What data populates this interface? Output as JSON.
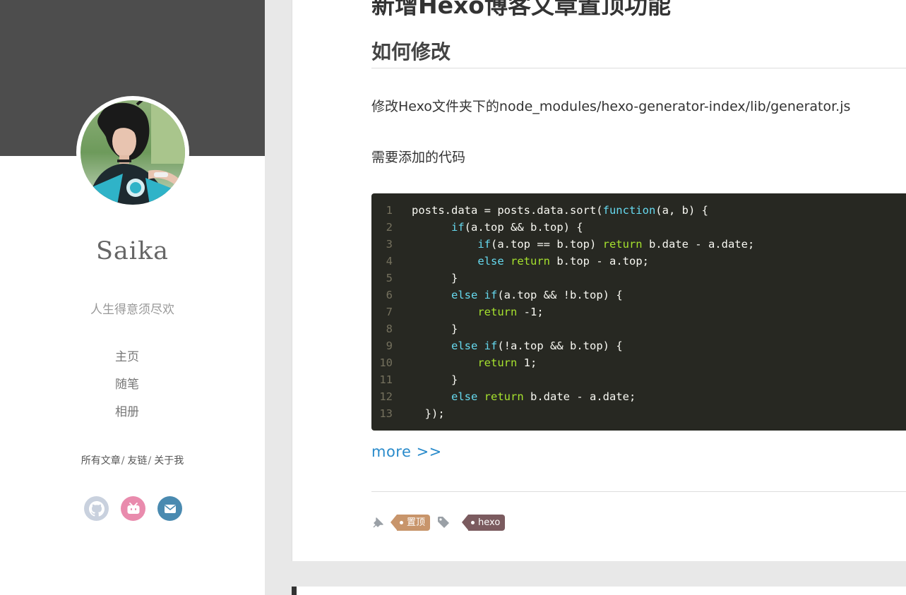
{
  "sidebar": {
    "author_name": "Saika",
    "motto": "人生得意须尽欢",
    "nav": [
      {
        "label": "主页"
      },
      {
        "label": "随笔"
      },
      {
        "label": "相册"
      }
    ],
    "sub_nav": [
      {
        "label": "所有文章"
      },
      {
        "label": "友链"
      },
      {
        "label": "关于我"
      }
    ],
    "sub_nav_separator": "/",
    "socials": [
      {
        "icon": "github-icon",
        "color": "#c9d1de"
      },
      {
        "icon": "bilibili-icon",
        "color": "#e98bad"
      },
      {
        "icon": "email-icon",
        "color": "#4a8ab0"
      }
    ]
  },
  "post": {
    "title": "新增Hexo博客文章置顶功能",
    "section_heading": "如何修改",
    "paragraph_1": "修改Hexo文件夹下的node_modules/hexo-generator-index/lib/generator.js",
    "paragraph_2": "需要添加的代码",
    "code_lines": [
      {
        "n": "1",
        "indent": "",
        "parts": [
          [
            "t",
            "posts.data = posts.data.sort("
          ],
          [
            "kw",
            "function"
          ],
          [
            "t",
            "(a, b) {"
          ]
        ]
      },
      {
        "n": "2",
        "indent": "      ",
        "parts": [
          [
            "kw",
            "if"
          ],
          [
            "t",
            "(a.top && b.top) {"
          ]
        ]
      },
      {
        "n": "3",
        "indent": "          ",
        "parts": [
          [
            "kw",
            "if"
          ],
          [
            "t",
            "(a.top == b.top) "
          ],
          [
            "kw2",
            "return"
          ],
          [
            "t",
            " b.date - a.date;"
          ]
        ]
      },
      {
        "n": "4",
        "indent": "          ",
        "parts": [
          [
            "kw",
            "else"
          ],
          [
            "t",
            " "
          ],
          [
            "kw2",
            "return"
          ],
          [
            "t",
            " b.top - a.top;"
          ]
        ]
      },
      {
        "n": "5",
        "indent": "      ",
        "parts": [
          [
            "t",
            "}"
          ]
        ]
      },
      {
        "n": "6",
        "indent": "      ",
        "parts": [
          [
            "kw",
            "else"
          ],
          [
            "t",
            " "
          ],
          [
            "kw",
            "if"
          ],
          [
            "t",
            "(a.top && !b.top) {"
          ]
        ]
      },
      {
        "n": "7",
        "indent": "          ",
        "parts": [
          [
            "kw2",
            "return"
          ],
          [
            "t",
            " -1;"
          ]
        ]
      },
      {
        "n": "8",
        "indent": "      ",
        "parts": [
          [
            "t",
            "}"
          ]
        ]
      },
      {
        "n": "9",
        "indent": "      ",
        "parts": [
          [
            "kw",
            "else"
          ],
          [
            "t",
            " "
          ],
          [
            "kw",
            "if"
          ],
          [
            "t",
            "(!a.top && b.top) {"
          ]
        ]
      },
      {
        "n": "10",
        "indent": "          ",
        "parts": [
          [
            "kw2",
            "return"
          ],
          [
            "t",
            " 1;"
          ]
        ]
      },
      {
        "n": "11",
        "indent": "      ",
        "parts": [
          [
            "t",
            "}"
          ]
        ]
      },
      {
        "n": "12",
        "indent": "      ",
        "parts": [
          [
            "kw",
            "else"
          ],
          [
            "t",
            " "
          ],
          [
            "kw2",
            "return"
          ],
          [
            "t",
            " b.date - a.date;"
          ]
        ]
      },
      {
        "n": "13",
        "indent": "  ",
        "parts": [
          [
            "t",
            "});"
          ]
        ]
      }
    ],
    "more_link": "more >>",
    "tags": [
      {
        "label": "置顶",
        "color": "#c8956b"
      },
      {
        "label": "hexo",
        "color": "#7b5b5f"
      }
    ]
  }
}
